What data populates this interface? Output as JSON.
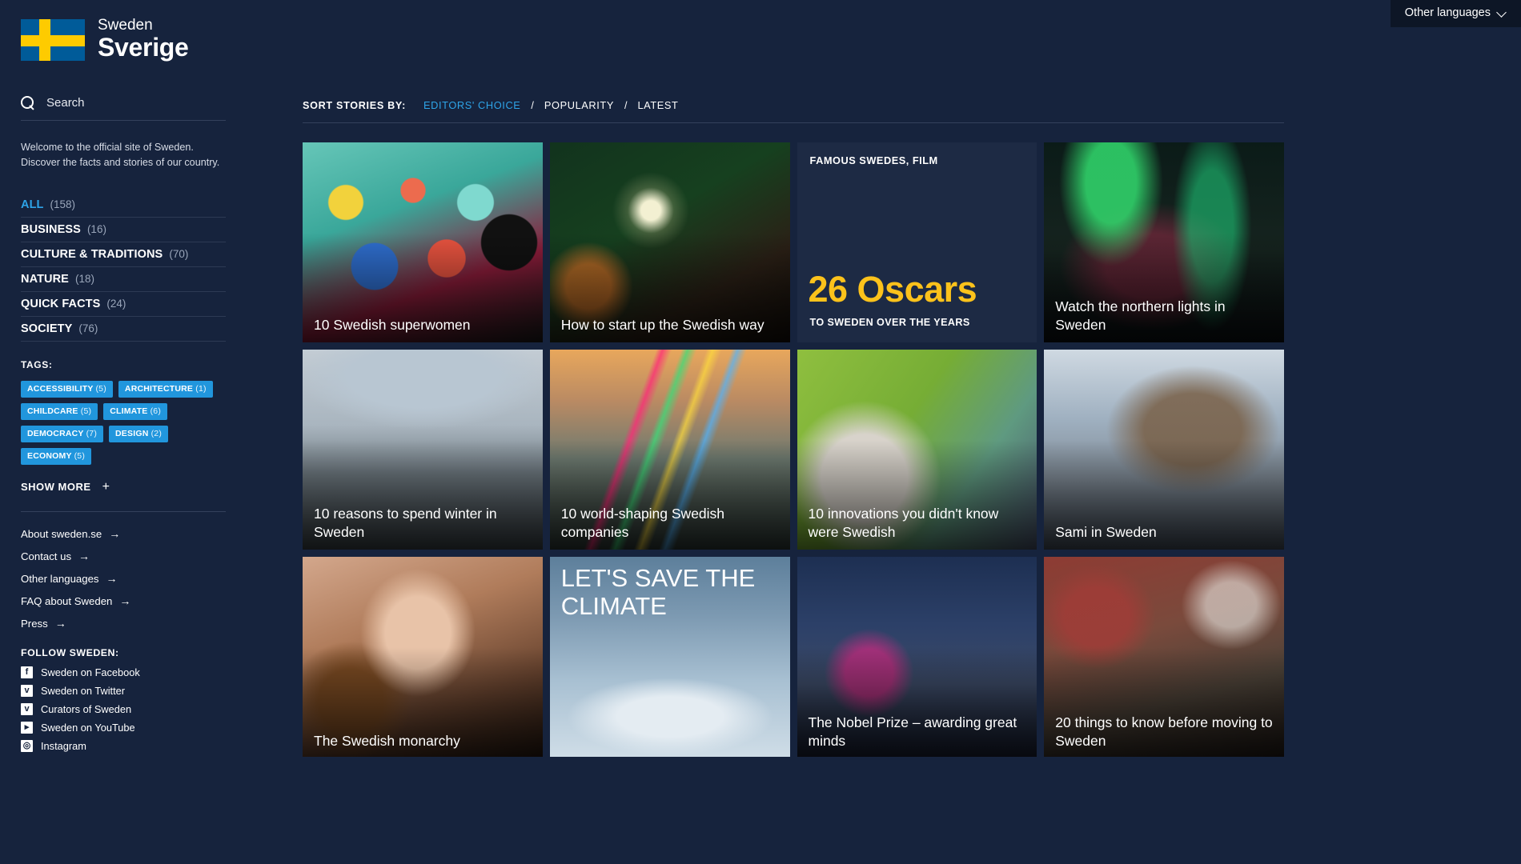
{
  "language_bar": {
    "label": "Other languages",
    "icon": "chevron-down-icon"
  },
  "sidebar": {
    "brand": {
      "country_en": "Sweden",
      "country_sv": "Sverige",
      "flag_icon": "sweden-flag-icon"
    },
    "search": {
      "placeholder": "Search",
      "icon": "search-icon"
    },
    "welcome": "Welcome to the official site of Sweden. Discover the facts and stories of our country.",
    "categories": [
      {
        "label": "ALL",
        "count": "(158)",
        "active": true
      },
      {
        "label": "BUSINESS",
        "count": "(16)",
        "active": false
      },
      {
        "label": "CULTURE & TRADITIONS",
        "count": "(70)",
        "active": false
      },
      {
        "label": "NATURE",
        "count": "(18)",
        "active": false
      },
      {
        "label": "QUICK FACTS",
        "count": "(24)",
        "active": false
      },
      {
        "label": "SOCIETY",
        "count": "(76)",
        "active": false
      }
    ],
    "tags_label": "TAGS:",
    "tags": [
      {
        "label": "ACCESSIBILITY",
        "count": "(5)"
      },
      {
        "label": "ARCHITECTURE",
        "count": "(1)"
      },
      {
        "label": "CHILDCARE",
        "count": "(5)"
      },
      {
        "label": "CLIMATE",
        "count": "(6)"
      },
      {
        "label": "DEMOCRACY",
        "count": "(7)"
      },
      {
        "label": "DESIGN",
        "count": "(2)"
      },
      {
        "label": "ECONOMY",
        "count": "(5)"
      }
    ],
    "show_more": {
      "label": "SHOW MORE",
      "plus": "+"
    },
    "footer_links": [
      {
        "label": "About sweden.se",
        "arrow": "→"
      },
      {
        "label": "Contact us",
        "arrow": "→"
      },
      {
        "label": "Other languages",
        "arrow": "→"
      },
      {
        "label": "FAQ about Sweden",
        "arrow": "→"
      },
      {
        "label": "Press",
        "arrow": "→"
      }
    ],
    "follow_label": "FOLLOW SWEDEN:",
    "social": [
      {
        "label": "Sweden on Facebook",
        "glyph": "f",
        "icon": "facebook-icon"
      },
      {
        "label": "Sweden on Twitter",
        "glyph": "ᴠ",
        "icon": "twitter-icon"
      },
      {
        "label": "Curators of Sweden",
        "glyph": "ᴠ",
        "icon": "twitter-icon"
      },
      {
        "label": "Sweden on YouTube",
        "glyph": "▸",
        "icon": "youtube-icon"
      },
      {
        "label": "Instagram",
        "glyph": "◎",
        "icon": "instagram-icon"
      }
    ]
  },
  "main": {
    "sort": {
      "label": "SORT STORIES BY:",
      "separator": "/",
      "options": [
        {
          "label": "EDITORS' CHOICE",
          "active": true
        },
        {
          "label": "POPULARITY",
          "active": false
        },
        {
          "label": "LATEST",
          "active": false
        }
      ]
    },
    "cards": [
      {
        "type": "story",
        "title": "10 Swedish superwomen",
        "image": "img-superwomen"
      },
      {
        "type": "story",
        "title": "How to start up the Swedish way",
        "image": "img-startup"
      },
      {
        "type": "stat",
        "kicker": "FAMOUS SWEDES, FILM",
        "stat_value": "26 Oscars",
        "stat_sub": "TO SWEDEN OVER THE YEARS",
        "accent_color": "#fcc21b"
      },
      {
        "type": "story",
        "title": "Watch the northern lights in Sweden",
        "image": "img-aurora"
      },
      {
        "type": "story",
        "title": "10 reasons to spend winter in Sweden",
        "image": "img-winter"
      },
      {
        "type": "story",
        "title": "10 world-shaping Swedish companies",
        "image": "img-companies"
      },
      {
        "type": "story",
        "title": "10 innovations you didn't know were Swedish",
        "image": "img-innov"
      },
      {
        "type": "story",
        "title": "Sami in Sweden",
        "image": "img-sami"
      },
      {
        "type": "story",
        "title": "The Swedish monarchy",
        "image": "img-monarchy"
      },
      {
        "type": "climate",
        "headline": "LET'S SAVE THE CLIMATE",
        "image": "img-climate"
      },
      {
        "type": "story",
        "title": "The Nobel Prize – awarding great minds",
        "image": "img-nobel"
      },
      {
        "type": "story",
        "title": "20 things to know before moving to Sweden",
        "image": "img-moving"
      }
    ]
  }
}
